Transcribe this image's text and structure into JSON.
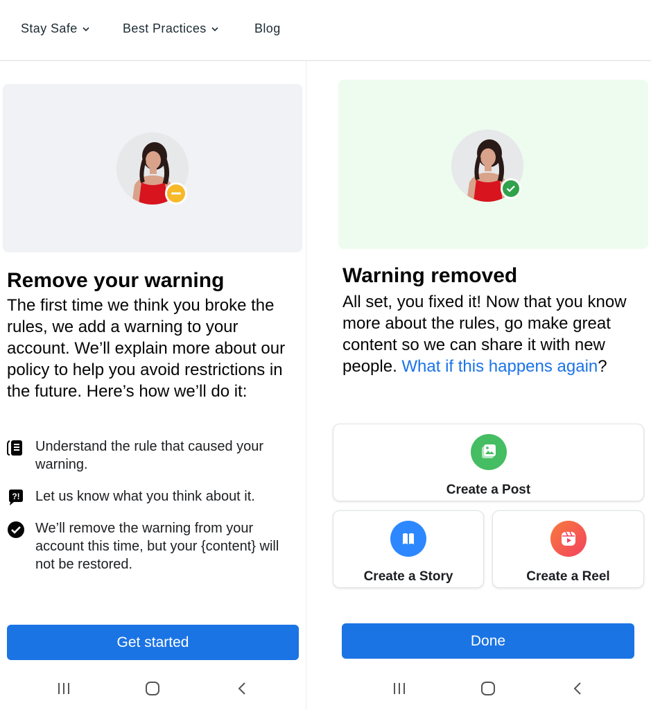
{
  "nav": {
    "items": [
      {
        "label": "Stay Safe",
        "has_dropdown": true
      },
      {
        "label": "Best Practices",
        "has_dropdown": true
      },
      {
        "label": "Blog",
        "has_dropdown": false
      }
    ]
  },
  "left": {
    "status": "warning",
    "badge_color": "#f7b928",
    "title": "Remove your warning",
    "intro": "The first time we think you broke the rules, we add a warning to your account. We’ll explain more about our policy to help you avoid restrictions in the future. Here’s how we’ll do it:",
    "steps": [
      {
        "icon": "rulebook-icon",
        "text": "Understand the rule that caused your warning."
      },
      {
        "icon": "feedback-bubble-icon",
        "text": "Let us know what you think about it."
      },
      {
        "icon": "checkmark-circle-icon",
        "text": "We’ll remove the warning from your account this time, but your {content} will not be restored."
      }
    ],
    "button_label": "Get started"
  },
  "right": {
    "status": "removed",
    "badge_color": "#31a24c",
    "title": "Warning removed",
    "text_before_link": "All set, you fixed it! Now that you know more about the rules, go make great content so we can share it with new people. ",
    "link_text": "What if this happens again",
    "text_after_link": "?",
    "actions": [
      {
        "label": "Create a Post",
        "icon": "photo-icon",
        "color": "#45bd62"
      },
      {
        "label": "Create a Story",
        "icon": "book-icon",
        "color": "#2d88ff"
      },
      {
        "label": "Create a Reel",
        "icon": "reel-play-icon",
        "color": "#f3425f"
      }
    ],
    "button_label": "Done"
  },
  "colors": {
    "primary": "#1b74e4",
    "link": "#1a73e8",
    "hero_neutral": "#f0f2f5",
    "hero_success": "#edfcee"
  }
}
